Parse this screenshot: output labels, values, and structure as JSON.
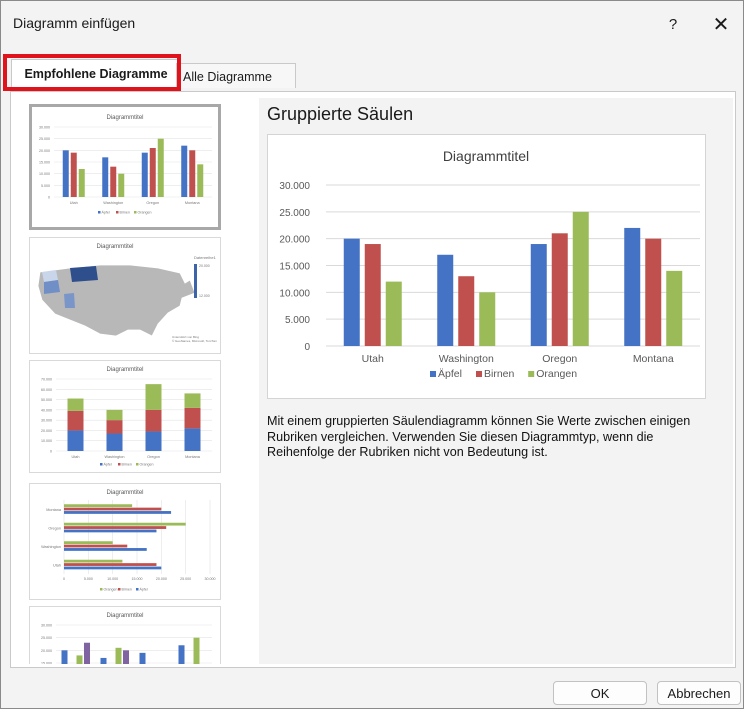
{
  "dialog": {
    "title": "Diagramm einfügen",
    "help_label": "?",
    "close_label": "✕"
  },
  "tabs": [
    {
      "label": "Empfohlene Diagramme",
      "active": true
    },
    {
      "label": "Alle Diagramme",
      "active": false
    }
  ],
  "thumbnails": [
    {
      "title": "Diagrammtitel",
      "kind": "clustered-column",
      "selected": true
    },
    {
      "title": "Diagrammtitel",
      "kind": "map"
    },
    {
      "title": "Diagrammtitel",
      "kind": "stacked-column"
    },
    {
      "title": "Diagrammtitel",
      "kind": "clustered-bar"
    },
    {
      "title": "Diagrammtitel",
      "kind": "clustered-column-4"
    }
  ],
  "preview": {
    "heading": "Gruppierte Säulen",
    "description": "Mit einem gruppierten Säulendiagramm können Sie Werte zwischen einigen Rubriken vergleichen. Verwenden Sie diesen Diagrammtyp, wenn die Reihenfolge der Rubriken nicht von Bedeutung ist."
  },
  "chart_data": {
    "type": "bar",
    "title": "Diagrammtitel",
    "categories": [
      "Utah",
      "Washington",
      "Oregon",
      "Montana"
    ],
    "series": [
      {
        "name": "Äpfel",
        "color": "#4472c4",
        "values": [
          20000,
          17000,
          19000,
          22000
        ]
      },
      {
        "name": "Birnen",
        "color": "#c0504d",
        "values": [
          19000,
          13000,
          21000,
          20000
        ]
      },
      {
        "name": "Orangen",
        "color": "#9bbb59",
        "values": [
          12000,
          10000,
          25000,
          14000
        ]
      }
    ],
    "ylim": [
      0,
      30000
    ],
    "yticks": [
      "0",
      "5.000",
      "10.000",
      "15.000",
      "20.000",
      "25.000",
      "30.000"
    ],
    "grid": true,
    "legend": "bottom"
  },
  "buttons": {
    "ok": "OK",
    "cancel": "Abbrechen"
  },
  "colors": {
    "accent_highlight": "#e0131c",
    "series_blue": "#4472c4",
    "series_red": "#c0504d",
    "series_green": "#9bbb59",
    "series_purple": "#8064a2"
  }
}
